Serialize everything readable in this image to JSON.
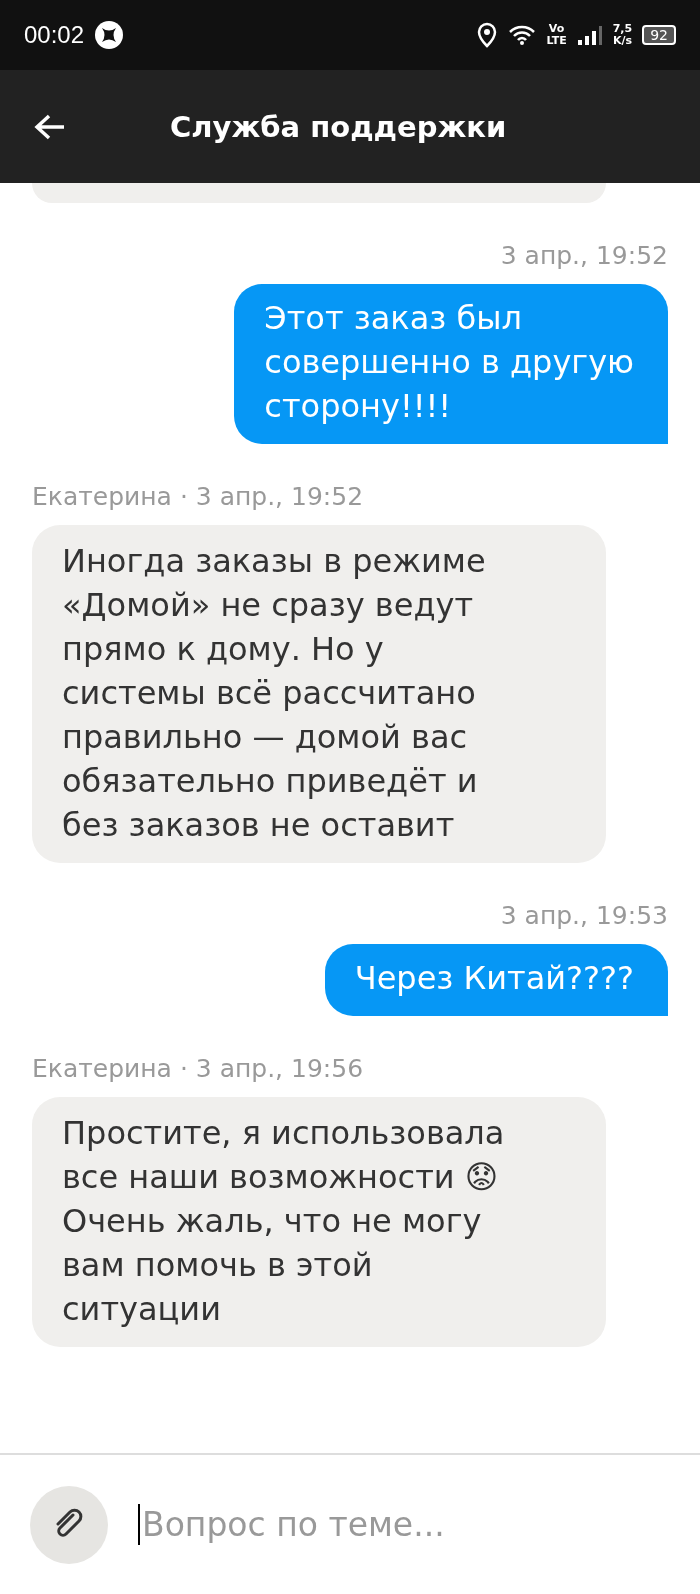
{
  "status_bar": {
    "time": "00:02",
    "network": "Vo\nLTE",
    "speed": "7,5\nK/s",
    "battery": "92"
  },
  "header": {
    "title": "Служба поддержки"
  },
  "messages": [
    {
      "kind": "outgoing",
      "meta": "3 апр., 19:52",
      "text": "Этот заказ был\nсовершенно в другую\nсторону!!!!"
    },
    {
      "kind": "incoming",
      "meta": "Екатерина · 3 апр., 19:52",
      "text": "Иногда заказы в режиме\n«Домой» не сразу ведут\nпрямо к дому. Но у\nсистемы всё рассчитано\nправильно — домой вас\nобязательно приведёт и\nбез заказов не оставит"
    },
    {
      "kind": "outgoing",
      "meta": "3 апр., 19:53",
      "text": "Через Китай????"
    },
    {
      "kind": "incoming",
      "meta": "Екатерина · 3 апр., 19:56",
      "text": "Простите, я использовала\nвсе наши возможности 😟\nОчень жаль, что не могу\nвам помочь в этой\nситуации"
    }
  ],
  "composer": {
    "placeholder": "Вопрос по теме..."
  }
}
